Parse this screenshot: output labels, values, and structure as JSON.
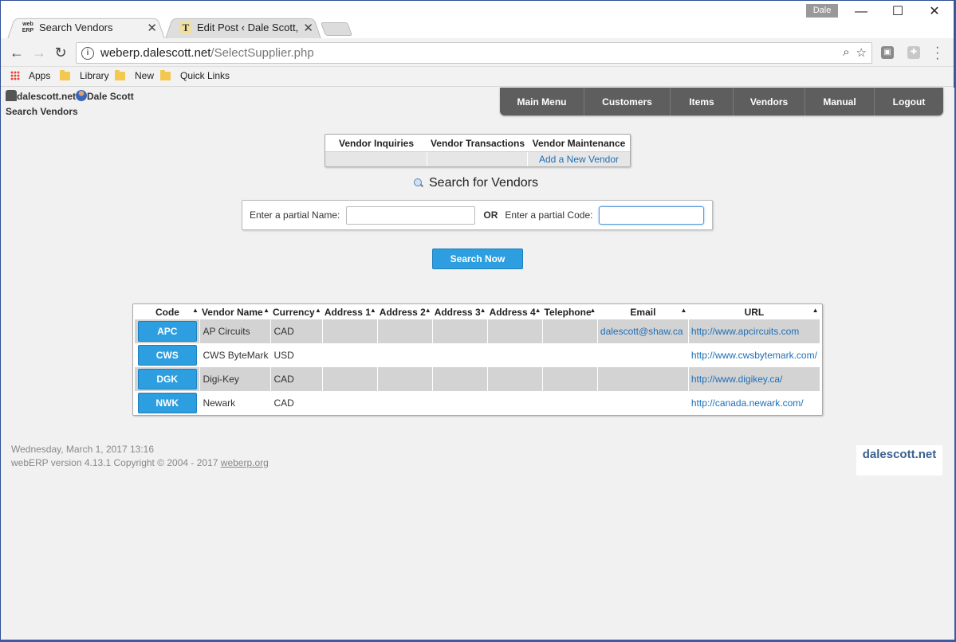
{
  "browser": {
    "tabs": [
      {
        "title": "Search Vendors",
        "favicon": "web ERP",
        "active": true
      },
      {
        "title": "Edit Post ‹ Dale Scott, P.E",
        "favicon": "T",
        "active": false
      }
    ],
    "profile": "Dale",
    "url_host": "weberp.dalescott.net",
    "url_path": "/SelectSupplier.php",
    "bookmarks": [
      {
        "label": "Apps",
        "icon": "apps-grid-icon"
      },
      {
        "label": "Library",
        "icon": "folder-icon"
      },
      {
        "label": "New",
        "icon": "folder-icon"
      },
      {
        "label": "Quick Links",
        "icon": "folder-icon"
      }
    ]
  },
  "header": {
    "company": "dalescott.net",
    "user": "Dale Scott",
    "page_title": "Search Vendors"
  },
  "mainnav": [
    "Main Menu",
    "Customers",
    "Items",
    "Vendors",
    "Manual",
    "Logout"
  ],
  "submenu": {
    "headers": [
      "Vendor Inquiries",
      "Vendor Transactions",
      "Vendor Maintenance"
    ],
    "add_link": "Add a New Vendor"
  },
  "search": {
    "title": "Search for Vendors",
    "name_label": "Enter a partial Name:",
    "or_label": "OR",
    "code_label": "Enter a partial Code:",
    "name_value": "",
    "code_value": "",
    "button": "Search Now"
  },
  "results": {
    "columns": [
      "Code",
      "Vendor Name",
      "Currency",
      "Address 1",
      "Address 2",
      "Address 3",
      "Address 4",
      "Telephone",
      "Email",
      "URL"
    ],
    "rows": [
      {
        "code": "APC",
        "name": "AP Circuits",
        "currency": "CAD",
        "email": "dalescott@shaw.ca",
        "url": "http://www.apcircuits.com"
      },
      {
        "code": "CWS",
        "name": "CWS ByteMark",
        "currency": "USD",
        "email": "",
        "url": "http://www.cwsbytemark.com/"
      },
      {
        "code": "DGK",
        "name": "Digi-Key",
        "currency": "CAD",
        "email": "",
        "url": "http://www.digikey.ca/"
      },
      {
        "code": "NWK",
        "name": "Newark",
        "currency": "CAD",
        "email": "",
        "url": "http://canada.newark.com/"
      }
    ]
  },
  "footer": {
    "date": "Wednesday, March 1, 2017 13:16",
    "version": "webERP version 4.13.1 Copyright © 2004 - 2017",
    "link": "weberp.org",
    "brand": "dalescott.net"
  },
  "colors": {
    "accent": "#2d9ee0",
    "nav": "#5e5e5e",
    "link": "#1e6fb6",
    "row_alt": "#d3d3d3"
  }
}
